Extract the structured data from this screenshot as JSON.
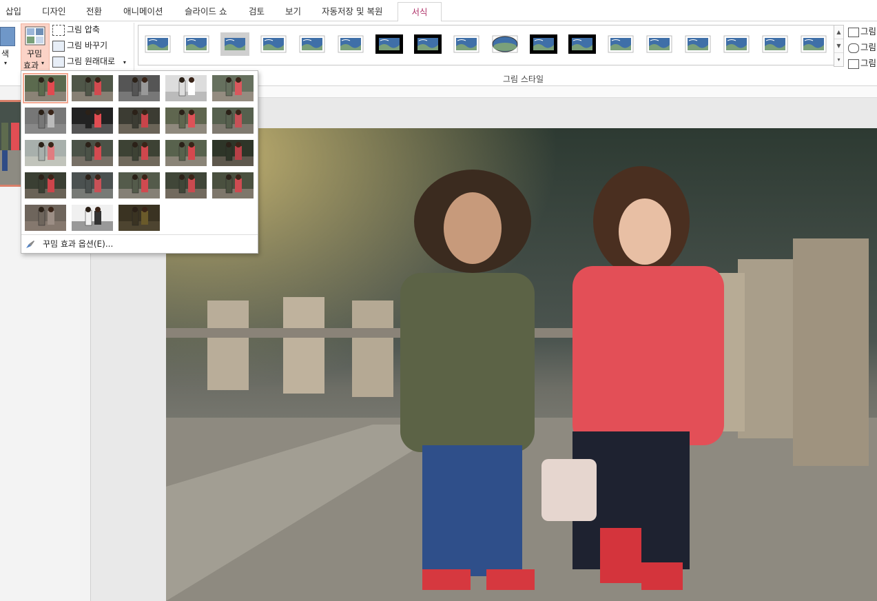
{
  "tabs": [
    {
      "label": "삽입",
      "active": false
    },
    {
      "label": "디자인",
      "active": false
    },
    {
      "label": "전환",
      "active": false
    },
    {
      "label": "애니메이션",
      "active": false
    },
    {
      "label": "슬라이드 쇼",
      "active": false
    },
    {
      "label": "검토",
      "active": false
    },
    {
      "label": "보기",
      "active": false
    },
    {
      "label": "자동저장 및 복원",
      "active": false
    },
    {
      "label": "서식",
      "active": true
    }
  ],
  "ribbon": {
    "color_label": "색",
    "artistic_effects_line1": "꾸밈",
    "artistic_effects_line2": "효과",
    "compress_label": "그림 압축",
    "change_label": "그림 바꾸기",
    "reset_label": "그림 원래대로",
    "picture_styles_group": "그림 스타일",
    "right_items": [
      "그림",
      "그림",
      "그림"
    ]
  },
  "artistic_effects_menu": {
    "option_label": "꾸밈 효과 옵션(E)..."
  },
  "colors": {
    "accent": "#b0346a",
    "selected_outline": "#f3a791"
  }
}
